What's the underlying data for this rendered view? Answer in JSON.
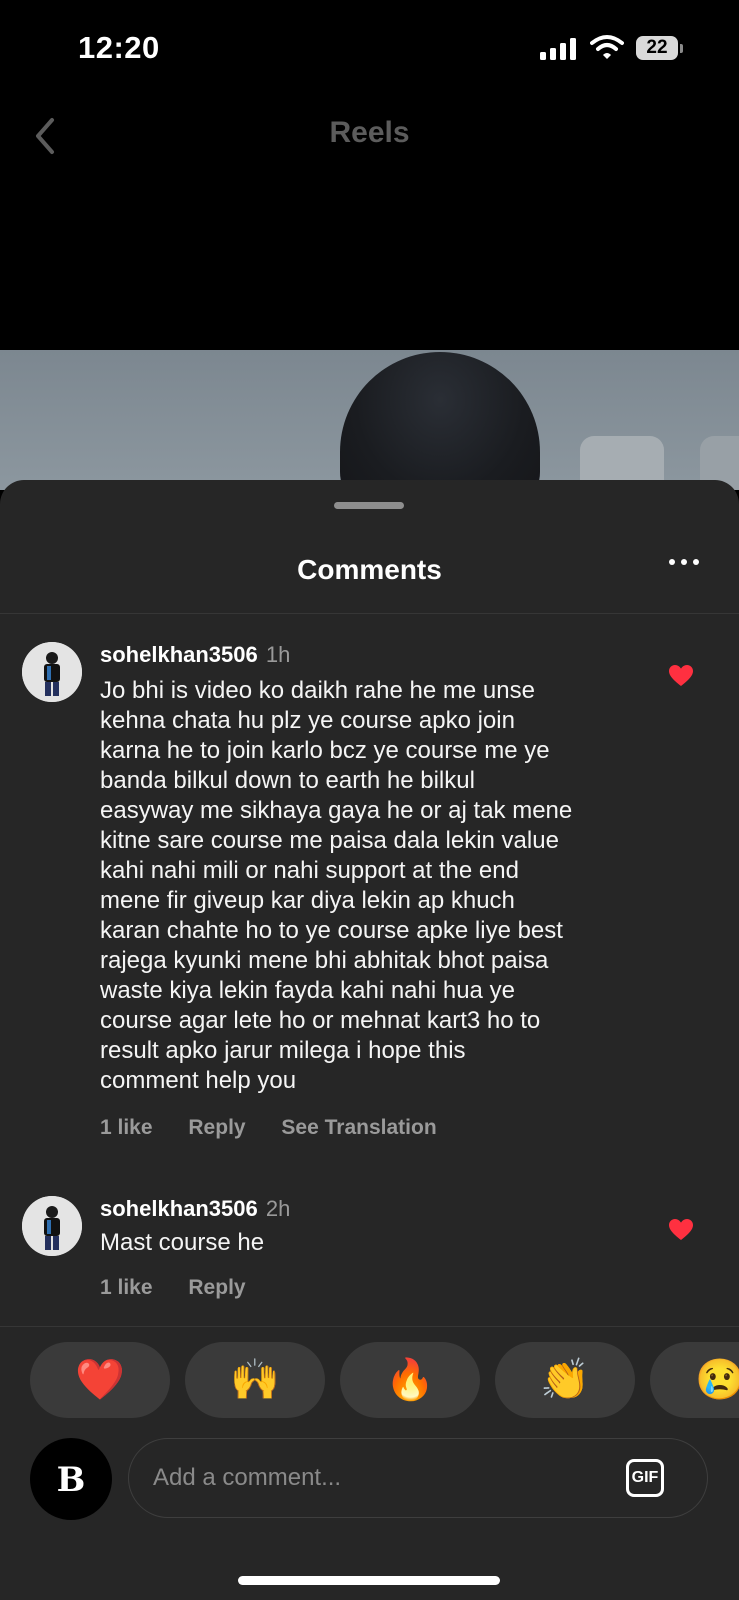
{
  "status_bar": {
    "time": "12:20",
    "battery": "22"
  },
  "nav": {
    "title": "Reels"
  },
  "sheet": {
    "title": "Comments"
  },
  "comments": [
    {
      "username": "sohelkhan3506",
      "time": "1h",
      "lines": [
        "Jo bhi is video ko daikh rahe he me unse",
        "kehna chata hu plz ye course apko join",
        "karna he to join karlo bcz ye course me ye",
        "banda bilkul down to earth he bilkul",
        "easyway me sikhaya gaya he or aj tak mene",
        "kitne sare course me paisa dala lekin value",
        "kahi nahi mili or nahi support at the end",
        "mene fir giveup kar diya lekin ap khuch",
        "karan chahte ho to ye course apke liye best",
        "rajega kyunki mene bhi abhitak bhot paisa",
        "waste kiya lekin fayda kahi nahi hua ye",
        "course agar lete ho or mehnat kart3 ho to",
        "result apko jarur milega i hope this",
        "comment help you"
      ],
      "likes": "1 like",
      "reply": "Reply",
      "translate": "See Translation"
    },
    {
      "username": "sohelkhan3506",
      "time": "2h",
      "text": "Mast course he",
      "likes": "1 like",
      "reply": "Reply"
    }
  ],
  "reactions": [
    "❤️",
    "🙌",
    "🔥",
    "👏",
    "😢"
  ],
  "composer": {
    "avatar_letter": "B",
    "placeholder": "Add a comment...",
    "gif_label": "GIF"
  },
  "colors": {
    "heart": "#ff3040",
    "sheet_bg": "#262626",
    "reaction_bg": "#3a3a3a"
  }
}
